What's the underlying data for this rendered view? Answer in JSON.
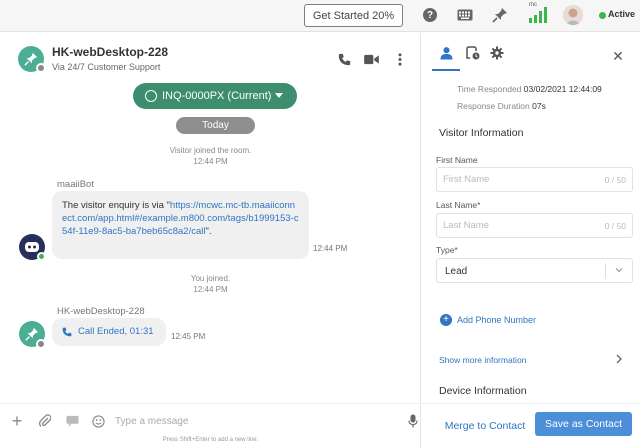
{
  "topbar": {
    "get_started_label": "Get Started 20%",
    "help_icon": "help-icon",
    "keyboard_icon": "keyboard-icon",
    "pin_icon": "pin-icon",
    "signal_label": "mc",
    "status_label": "Active",
    "status_color": "#3cb54a"
  },
  "conversation": {
    "title": "HK-webDesktop-228",
    "subtitle": "Via 24/7 Customer Support",
    "inquiry_label": "INQ-0000PX (Current)",
    "date_divider": "Today",
    "accent_color": "#3d8e6e"
  },
  "messages": {
    "visitor_joined": "Visitor joined the room.",
    "visitor_joined_time": "12:44 PM",
    "bot_name": "maaiiBot",
    "bot_text_prefix": "The visitor enquiry is via \"",
    "bot_link": "https://mcwc.mc-tb.maaiiconnect.com/app.html#/example.m800.com/tags/b1999153-c54f-11e9-8ac5-ba7beb65c8a2/call",
    "bot_text_suffix": "\".",
    "bot_time": "12:44 PM",
    "you_joined": "You joined.",
    "you_joined_time": "12:44 PM",
    "agent_name": "HK-webDesktop-228",
    "call_text": "Call Ended, 01:31",
    "call_time": "12:45 PM"
  },
  "composer": {
    "placeholder": "Type a message",
    "hint": "Press Shift+Enter to add a new line."
  },
  "side": {
    "time_responded_label": "Time Responded",
    "time_responded_value": "03/02/2021 12:44:09",
    "response_duration_label": "Response Duration",
    "response_duration_value": "07s",
    "visitor_info_title": "Visitor Information",
    "first_name_label": "First Name",
    "first_name_placeholder": "First Name",
    "first_name_count": "0 / 50",
    "last_name_label": "Last Name*",
    "last_name_placeholder": "Last Name",
    "last_name_count": "0 / 50",
    "type_label": "Type*",
    "type_value": "Lead",
    "add_phone_label": "Add Phone Number",
    "show_more_label": "Show more information",
    "device_info_title": "Device Information",
    "merge_label": "Merge to Contact",
    "save_label": "Save as Contact",
    "primary_color": "#4d8ed8"
  }
}
